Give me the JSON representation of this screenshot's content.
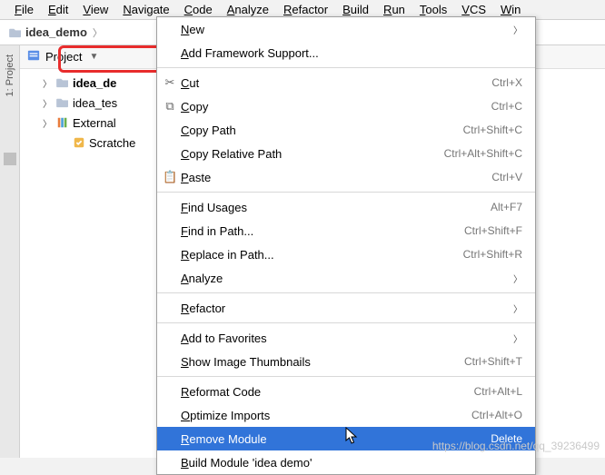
{
  "menubar": [
    "File",
    "Edit",
    "View",
    "Navigate",
    "Code",
    "Analyze",
    "Refactor",
    "Build",
    "Run",
    "Tools",
    "VCS",
    "Win"
  ],
  "breadcrumb": {
    "project": "idea_demo"
  },
  "panel": {
    "title": "Project"
  },
  "tree": {
    "items": [
      {
        "label": "idea_de",
        "icon": "folder",
        "depth": 1,
        "arrow": true,
        "hl": true
      },
      {
        "label": "idea_tes",
        "icon": "folder",
        "depth": 1,
        "arrow": true
      },
      {
        "label": "External",
        "icon": "lib",
        "depth": 1,
        "arrow": true
      },
      {
        "label": "Scratche",
        "icon": "scratch",
        "depth": 2,
        "arrow": false
      }
    ]
  },
  "context": [
    {
      "label": "New",
      "sub": true
    },
    {
      "label": "Add Framework Support..."
    },
    {
      "sep": true
    },
    {
      "label": "Cut",
      "shortcut": "Ctrl+X",
      "icon": "cut"
    },
    {
      "label": "Copy",
      "shortcut": "Ctrl+C",
      "icon": "copy"
    },
    {
      "label": "Copy Path",
      "shortcut": "Ctrl+Shift+C"
    },
    {
      "label": "Copy Relative Path",
      "shortcut": "Ctrl+Alt+Shift+C"
    },
    {
      "label": "Paste",
      "shortcut": "Ctrl+V",
      "icon": "paste"
    },
    {
      "sep": true
    },
    {
      "label": "Find Usages",
      "shortcut": "Alt+F7"
    },
    {
      "label": "Find in Path...",
      "shortcut": "Ctrl+Shift+F"
    },
    {
      "label": "Replace in Path...",
      "shortcut": "Ctrl+Shift+R"
    },
    {
      "label": "Analyze",
      "sub": true
    },
    {
      "sep": true
    },
    {
      "label": "Refactor",
      "sub": true
    },
    {
      "sep": true
    },
    {
      "label": "Add to Favorites",
      "sub": true
    },
    {
      "label": "Show Image Thumbnails",
      "shortcut": "Ctrl+Shift+T"
    },
    {
      "sep": true
    },
    {
      "label": "Reformat Code",
      "shortcut": "Ctrl+Alt+L"
    },
    {
      "label": "Optimize Imports",
      "shortcut": "Ctrl+Alt+O"
    },
    {
      "label": "Remove Module",
      "shortcut": "Delete",
      "sel": true
    },
    {
      "label": "Build Module 'idea demo'"
    }
  ],
  "gutter": {
    "label": "1: Project"
  },
  "watermark": "https://blog.csdn.net/qq_39236499"
}
